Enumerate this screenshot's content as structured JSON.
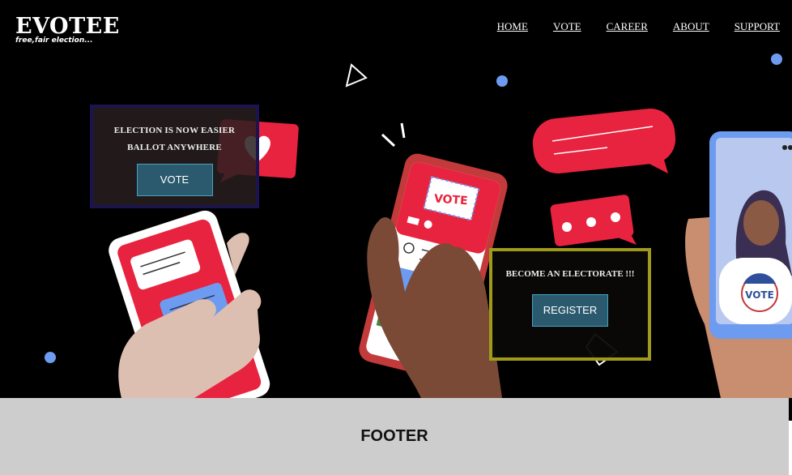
{
  "brand": {
    "title": "EVOTEE",
    "tagline": "free,fair election..."
  },
  "nav": {
    "items": [
      "HOME",
      "VOTE",
      "CAREER",
      "ABOUT",
      "SUPPORT"
    ]
  },
  "hero": {
    "box1": {
      "line1": "ELECTION IS NOW EASIER",
      "line2": "BALLOT ANYWHERE",
      "button": "VOTE"
    },
    "box2": {
      "line1": "BECOME AN ELECTORATE !!!",
      "button": "REGISTER"
    },
    "phone_sticker": "VOTE",
    "badge": "VOTE"
  },
  "footer": {
    "text": "FOOTER"
  },
  "colors": {
    "background": "#000000",
    "accent_red": "#e8233f",
    "accent_blue": "#6d9bf0",
    "footer_bg": "#cdcdcd",
    "button_bg": "#2b5a6e"
  },
  "icons": [
    "heart-icon",
    "speech-bubble-icon",
    "user-icon",
    "play-triangle-icon",
    "diamond-outline-icon"
  ]
}
